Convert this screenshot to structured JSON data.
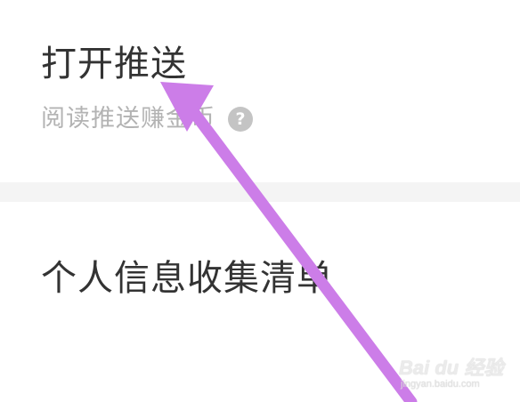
{
  "settings": {
    "push": {
      "title": "打开推送",
      "subtitle": "阅读推送赚金币",
      "help_icon": "question-mark-icon"
    },
    "info_list": {
      "title": "个人信息收集清单"
    }
  },
  "annotation": {
    "arrow_color": "#cc7de8",
    "arrow_target": "打开推送"
  },
  "watermark": {
    "logo_text": "Bai du 经验",
    "url": "jingyan.baidu.com"
  },
  "colors": {
    "title_text": "#333333",
    "subtitle_text": "#b3b3b3",
    "divider": "#f4f4f4",
    "help_icon_bg": "#c4c4c4"
  }
}
